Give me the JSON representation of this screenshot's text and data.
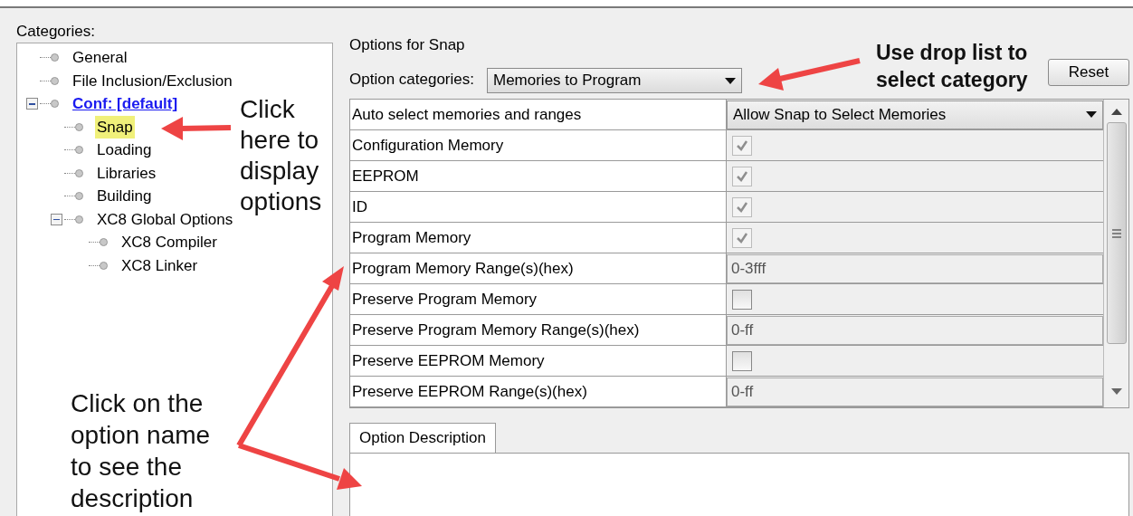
{
  "categories": {
    "label": "Categories:",
    "tree": [
      {
        "label": "General",
        "link": false,
        "selected": false
      },
      {
        "label": "File Inclusion/Exclusion",
        "link": false,
        "selected": false
      },
      {
        "label": "Conf: [default]",
        "link": true,
        "selected": false,
        "expanded": true,
        "children": [
          {
            "label": "Snap",
            "link": false,
            "selected": true
          },
          {
            "label": "Loading",
            "link": false,
            "selected": false
          },
          {
            "label": "Libraries",
            "link": false,
            "selected": false
          },
          {
            "label": "Building",
            "link": false,
            "selected": false
          },
          {
            "label": "XC8 Global Options",
            "link": false,
            "selected": false,
            "expanded": true,
            "children": [
              {
                "label": "XC8 Compiler",
                "link": false,
                "selected": false
              },
              {
                "label": "XC8 Linker",
                "link": false,
                "selected": false
              }
            ]
          }
        ]
      }
    ]
  },
  "options": {
    "title": "Options for Snap",
    "category_label": "Option categories:",
    "category_value": "Memories to Program",
    "reset": "Reset",
    "rows": [
      {
        "name": "Auto select memories and ranges",
        "kind": "dropdown",
        "value": "Allow Snap to Select Memories"
      },
      {
        "name": "Configuration Memory",
        "kind": "checkbox",
        "checked": true,
        "disabled": true
      },
      {
        "name": "EEPROM",
        "kind": "checkbox",
        "checked": true,
        "disabled": true
      },
      {
        "name": "ID",
        "kind": "checkbox",
        "checked": true,
        "disabled": true
      },
      {
        "name": "Program Memory",
        "kind": "checkbox",
        "checked": true,
        "disabled": true
      },
      {
        "name": "Program Memory Range(s)(hex)",
        "kind": "text",
        "value": "0-3fff"
      },
      {
        "name": "Preserve Program Memory",
        "kind": "checkbox",
        "checked": false,
        "disabled": false
      },
      {
        "name": "Preserve Program Memory Range(s)(hex)",
        "kind": "text",
        "value": "0-ff"
      },
      {
        "name": "Preserve EEPROM Memory",
        "kind": "checkbox",
        "checked": false,
        "disabled": false
      },
      {
        "name": "Preserve EEPROM Range(s)(hex)",
        "kind": "text",
        "value": "0-ff"
      }
    ],
    "description_tab": "Option Description"
  },
  "annotations": [
    {
      "kind": "tree",
      "text": "Click here to display options"
    },
    {
      "kind": "droplist",
      "text": "Use drop list to select category"
    },
    {
      "kind": "option",
      "text": "Click on the option name to see the description"
    }
  ]
}
